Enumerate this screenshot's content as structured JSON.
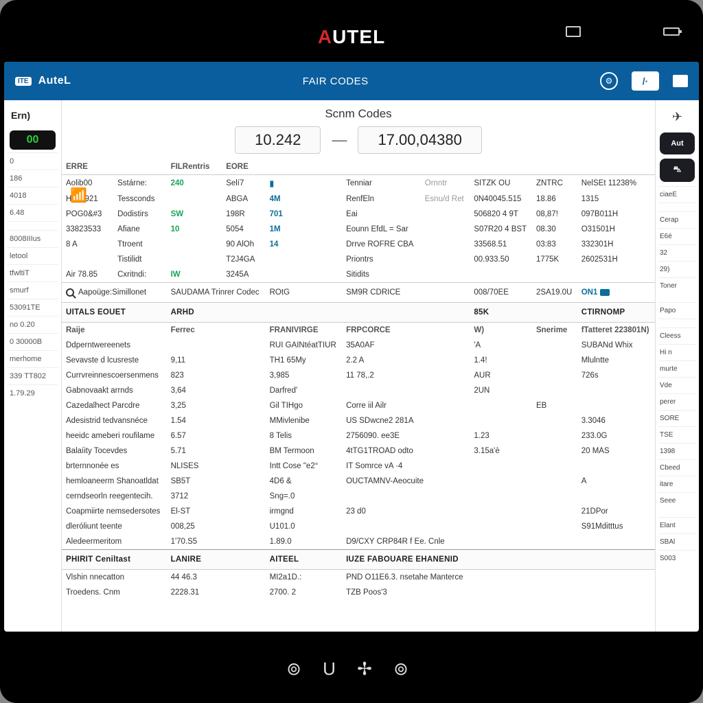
{
  "brand": {
    "a": "A",
    "rest": "UTEL"
  },
  "appbar": {
    "left_badge": "ITE",
    "left_logo": "AuteL",
    "center": "FAIR CODES",
    "slash": "/·"
  },
  "subheader": "Scnm Codes",
  "range": {
    "from": "10.242",
    "to": "17.00,04380"
  },
  "right_buttons": {
    "auto": "Aut",
    "car": "⛍"
  },
  "left_rail": {
    "label": "Ern)",
    "pill": "00",
    "rows": [
      "0",
      "186",
      "4018",
      "6.48",
      "",
      "8008IIIus",
      "letool",
      "tfwltiT",
      "smurf",
      "53091TE",
      "no 0.20",
      "0 30000B",
      "merhome",
      "339 TT802",
      "1.79.29"
    ]
  },
  "right_rail": {
    "plane": "✈",
    "rows_top": [
      "ciaeE",
      "",
      "Cerap",
      "E6é",
      "32",
      "29)",
      "Toner"
    ],
    "rows_mid": [
      "Papo",
      "",
      "Cleess",
      "Hi  n",
      "murte",
      "   Vde",
      "perer",
      "SORE",
      "TSE",
      "1398",
      "Cbeed",
      "itare",
      "Seee"
    ],
    "rows_bot": [
      "Elant",
      "SBAl",
      "S003"
    ]
  },
  "table1": {
    "headers": [
      "ERRE",
      "",
      "FILRentris",
      "EORE",
      "",
      "",
      "",
      "",
      "",
      ""
    ],
    "rows": [
      [
        "Aolib00",
        "Sstárne:",
        "240",
        "Selí7",
        "▮",
        "Tenniar",
        "Ornntr",
        "SITZK OU",
        "ZNTRC",
        "NelSEt   11238%"
      ],
      [
        "H/29/921",
        "Tessconds",
        "",
        "ABGA",
        "4M",
        "RenfEln",
        "Esnu/d Ret",
        "0N40045.515",
        "18.86",
        "1315"
      ],
      [
        "POG0&#3",
        "Dodistirs",
        "SW",
        "198R",
        "701",
        "Eai",
        "",
        "506820  4 9T",
        "08,87!",
        "097B011H"
      ],
      [
        "33823533",
        "Afiane",
        "10",
        "5054",
        "1M",
        "Eounn EfdL  =  Sar",
        "",
        "S07R20  4 BST",
        "08.30",
        "O31501H"
      ],
      [
        "8 A",
        "Ttroent",
        "",
        "90 AlOh",
        "14",
        "Drrve  ROFRE   CBA",
        "",
        "33568.51",
        "03:83",
        "332301H"
      ],
      [
        "",
        "Tistilidt",
        "",
        "T2J4GA",
        "",
        "Priontrs",
        "",
        "00.933.50",
        "1775K",
        "2602531H"
      ],
      [
        "Air  78.85",
        "Cxritndi:",
        "IW",
        "3245A",
        "",
        "Sitidits",
        "",
        "",
        "",
        ""
      ]
    ]
  },
  "search": {
    "label": "Aapoüge:Simillonet",
    "h1": "SAUDAMA Trinrer Codec",
    "h2": "ROtG",
    "h3": "SM9R CDRICE",
    "h4": "008/70EE",
    "h5": "2SA19.0U",
    "h6": "ON1"
  },
  "sections": [
    {
      "head": [
        "UITALS EOUET",
        "ARHD",
        "",
        "",
        "85K",
        "",
        "CTIRNOMP"
      ],
      "sub": [
        "Raije",
        "Ferrec",
        "FRANIVIRGE",
        "FRPCORCE",
        "W)",
        "Snerime",
        "fTatteret   223801N)"
      ],
      "rows": [
        [
          "Ddperntwereenets",
          "",
          "RUI GAINtéatTIUR",
          "35A0AF",
          "'A",
          "",
          "SUBANd Whix"
        ],
        [
          "Sevavste d lcusreste",
          "9,11",
          "TH1 65My",
          "2.2 A",
          "1.4!",
          "",
          "Mlulntte"
        ],
        [
          "Currvreinnescoersenmens",
          "823",
          "3,985",
          "11 78,.2",
          "AUR",
          "",
          "726s"
        ],
        [
          "Gabnovaakt arrnds",
          "3,64",
          "Darfred'",
          "",
          "2UN",
          "",
          ""
        ],
        [
          "Cazedalhect Parcdre",
          "3,25",
          "Gil TIHgo",
          "Corre  iil  Ailr",
          "",
          "EB",
          ""
        ],
        [
          "Adesistrid tedvansnéce",
          "1.54",
          "MMivlenibe",
          "US SDwcne2   281A",
          "",
          "",
          "3.3046"
        ],
        [
          "heeidc ameberi roufilame",
          "6.57",
          "8 Telis",
          "2756090.   ee3E",
          "1.23",
          "",
          "233.0G"
        ],
        [
          "Balaíity Tocevdes",
          "5.71",
          "BM Termoon",
          "4tTG1TROAD  odto",
          "3.15a'è",
          "",
          "20 MAS"
        ]
      ]
    },
    {
      "rows": [
        [
          "brternnonée es",
          "NLISES",
          "Intt Cose  \"e2°",
          "IT Somrce  vA  ·4",
          "",
          "",
          ""
        ],
        [
          "hemloaneerm Shanoatldat",
          "SB5T",
          "4D6 &",
          "OUCTAMNV-Aeocuite",
          "",
          "",
          "A"
        ],
        [
          "cerndseorln reegentecih.",
          "3712",
          "Sng=.0",
          "",
          "",
          "",
          ""
        ],
        [
          "Coapmiirte nemsedersotes",
          "El-ST",
          "irmgnd",
          "23 d0",
          "",
          "",
          "21DPor"
        ],
        [
          "dleróliunt teente",
          "008,25",
          "U101.0",
          "",
          "",
          "",
          "S91Mditttus"
        ],
        [
          "Aledeermeritom",
          "1'70.S5",
          "1.89.0",
          "D9/CXY CRP84R  f Ee. Cnle",
          "",
          "",
          ""
        ]
      ]
    },
    {
      "head": [
        "PHIRIT Ceniltast",
        "LANIRE",
        "AITEEL",
        "IUZE  FABOUARE EHANENID",
        "",
        "",
        ""
      ],
      "rows": [
        [
          "Vlshin nnecatton",
          "44 46.3",
          "MI2a1D.:",
          "PND O11E6.3.  nsetahe Manterce",
          "",
          "",
          ""
        ],
        [
          "Troedens. Cnm",
          "2228.31",
          "2700. 2",
          "TZB Poos'3",
          "",
          "",
          ""
        ]
      ]
    }
  ],
  "navbar": "⊚ U ✢ ⊚"
}
